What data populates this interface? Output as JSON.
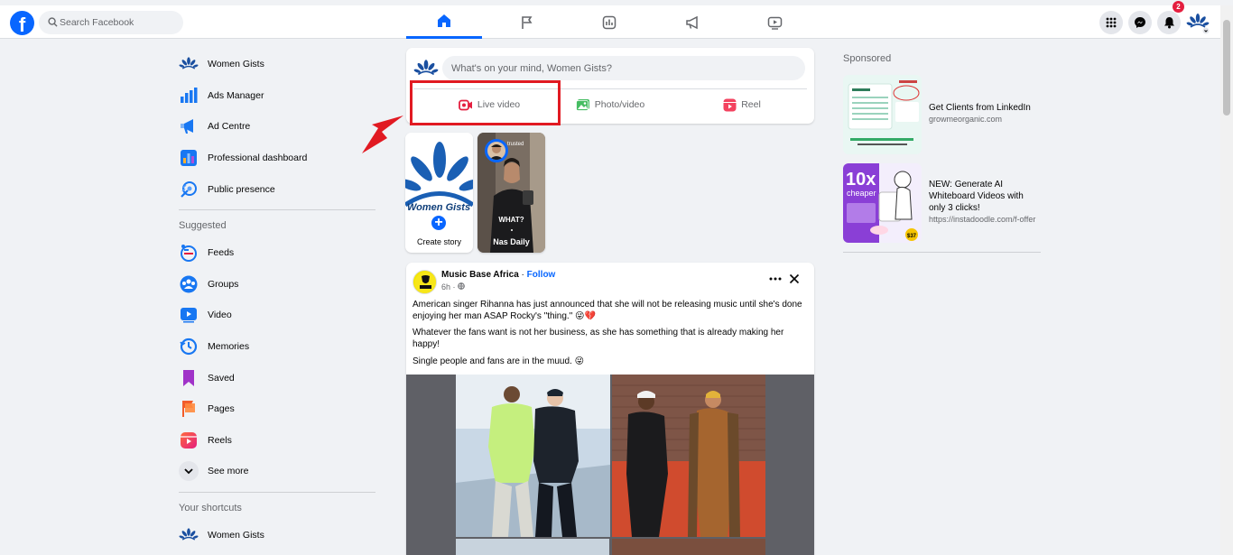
{
  "header": {
    "logo_letter": "f",
    "search_placeholder": "Search Facebook",
    "notification_count": "2",
    "nav_tabs": [
      "home",
      "pages",
      "dashboard",
      "ads",
      "watch"
    ]
  },
  "sidebar": {
    "items": [
      {
        "label": "Women Gists",
        "icon": "profile-avatar"
      },
      {
        "label": "Ads Manager",
        "icon": "ads-manager-icon"
      },
      {
        "label": "Ad Centre",
        "icon": "megaphone-icon"
      },
      {
        "label": "Professional dashboard",
        "icon": "dashboard-icon"
      },
      {
        "label": "Public presence",
        "icon": "public-presence-icon"
      }
    ],
    "suggested_title": "Suggested",
    "suggested": [
      {
        "label": "Feeds",
        "icon": "feeds-icon"
      },
      {
        "label": "Groups",
        "icon": "groups-icon"
      },
      {
        "label": "Video",
        "icon": "video-icon"
      },
      {
        "label": "Memories",
        "icon": "memories-icon"
      },
      {
        "label": "Saved",
        "icon": "saved-icon"
      },
      {
        "label": "Pages",
        "icon": "pages-icon"
      },
      {
        "label": "Reels",
        "icon": "reels-icon"
      },
      {
        "label": "See more",
        "icon": "chevron-down-icon"
      }
    ],
    "shortcuts_title": "Your shortcuts",
    "shortcuts": [
      {
        "label": "Women Gists",
        "icon": "profile-avatar"
      }
    ]
  },
  "composer": {
    "placeholder": "What's on your mind, Women Gists?",
    "live_label": "Live video",
    "photo_label": "Photo/video",
    "reel_label": "Reel"
  },
  "stories": {
    "create_label": "Create story",
    "create_brand": "Women Gists",
    "nas_label": "Nas Daily",
    "nas_overlay": "WHAT?",
    "nas_badge": "trusted"
  },
  "post": {
    "author": "Music Base Africa",
    "separator": " · ",
    "follow": "Follow",
    "time": "6h · ",
    "text1": "American singer Rihanna has just announced that she will not be releasing music until she's done enjoying her man ASAP Rocky's \"thing.\" 😜💔",
    "text2": "Whatever the fans want is not her business, as she has something that is already making her happy!",
    "text3": "Single people and fans are in the muud. 😜"
  },
  "sponsored": {
    "title": "Sponsored",
    "ads": [
      {
        "title": "Get Clients from LinkedIn",
        "url": "growmeorganic.com"
      },
      {
        "title": "NEW: Generate AI Whiteboard Videos with only 3 clicks!",
        "url": "https://instadoodle.com/f-offer",
        "badge_big": "10x",
        "badge_small": "cheaper",
        "price": "$37"
      }
    ]
  },
  "colors": {
    "accent": "#0866ff",
    "highlight": "#e11a22",
    "badge": "#e41e3f"
  }
}
